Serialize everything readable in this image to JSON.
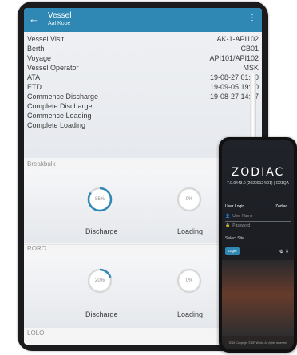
{
  "tablet": {
    "header": {
      "title": "Vessel",
      "subtitle": "Aal Kobe"
    },
    "fields": [
      {
        "label": "Vessel Visit",
        "value": "AK-1-API102"
      },
      {
        "label": "Berth",
        "value": "CB01"
      },
      {
        "label": "Voyage",
        "value": "API101/API102"
      },
      {
        "label": "Vessel Operator",
        "value": "MSK"
      },
      {
        "label": "ATA",
        "value": "19-08-27 01:00"
      },
      {
        "label": "ETD",
        "value": "19-09-05 19:30"
      },
      {
        "label": "Commence Discharge",
        "value": "19-08-27 14:07"
      },
      {
        "label": "Complete Discharge",
        "value": ""
      },
      {
        "label": "Commence Loading",
        "value": ""
      },
      {
        "label": "Complete Loading",
        "value": ""
      }
    ],
    "sections": [
      {
        "name": "Breakbulk",
        "discharge_percent": "85%",
        "loading_percent": "0%",
        "discharge_label": "Discharge",
        "loading_label": "Loading",
        "discharge_progress": 0.85,
        "loading_progress": 0
      },
      {
        "name": "RORO",
        "discharge_percent": "20%",
        "loading_percent": "0%",
        "discharge_label": "Discharge",
        "loading_label": "Loading",
        "discharge_progress": 0.2,
        "loading_progress": 0
      },
      {
        "name": "LOLO"
      }
    ]
  },
  "phone": {
    "logo": "ZODIAC",
    "version": "7.0.9443.0 (20200124/01) | C21QA",
    "user_login_label": "User Login",
    "company": "Zodiac",
    "username_placeholder": "User Name",
    "password_placeholder": "Password",
    "site_select": "Select Site ...",
    "login_button": "Login",
    "copyright": "2019 Copyright © DP World. All rights reserved"
  },
  "colors": {
    "accent": "#2f87b3",
    "gauge_track": "#d8d8d8"
  }
}
